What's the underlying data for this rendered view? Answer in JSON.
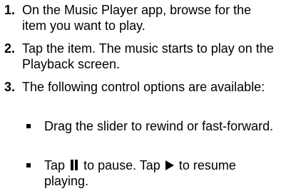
{
  "steps": [
    {
      "number": "1.",
      "text": "On the Music Player app, browse for the item you want to play."
    },
    {
      "number": "2.",
      "text": "Tap the item. The music starts to play on the Playback screen."
    },
    {
      "number": "3.",
      "text": "The following control options are available:"
    }
  ],
  "bullets": {
    "slider": {
      "text": "Drag the slider to rewind or fast-forward."
    },
    "pause_play": {
      "part1": "Tap",
      "pause_icon": "pause-icon",
      "part2": "to pause. Tap",
      "play_icon": "play-icon",
      "part3": "to resume playing."
    }
  }
}
